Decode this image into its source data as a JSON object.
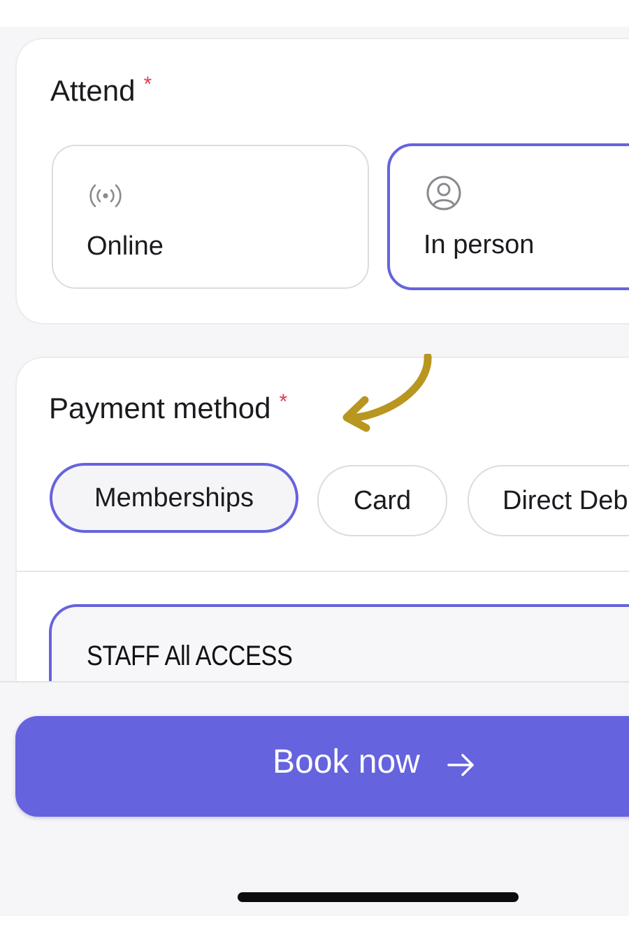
{
  "attend": {
    "label": "Attend",
    "required_mark": "*",
    "options": [
      {
        "label": "Online",
        "icon": "broadcast-icon",
        "selected": false
      },
      {
        "label": "In person",
        "icon": "user-circle-icon",
        "selected": true
      }
    ]
  },
  "payment": {
    "label": "Payment method",
    "required_mark": "*",
    "methods": [
      {
        "label": "Memberships",
        "selected": true
      },
      {
        "label": "Card",
        "selected": false
      },
      {
        "label": "Direct Debit",
        "selected": false
      }
    ],
    "membership": {
      "name": "STAFF All ACCESS",
      "selected": true
    }
  },
  "cta": {
    "label": "Book now",
    "icon": "arrow-right-icon"
  },
  "colors": {
    "accent": "#6663de",
    "required": "#e23a4e",
    "doodle_arrow": "#b8961f",
    "background": "#f6f6f8"
  }
}
